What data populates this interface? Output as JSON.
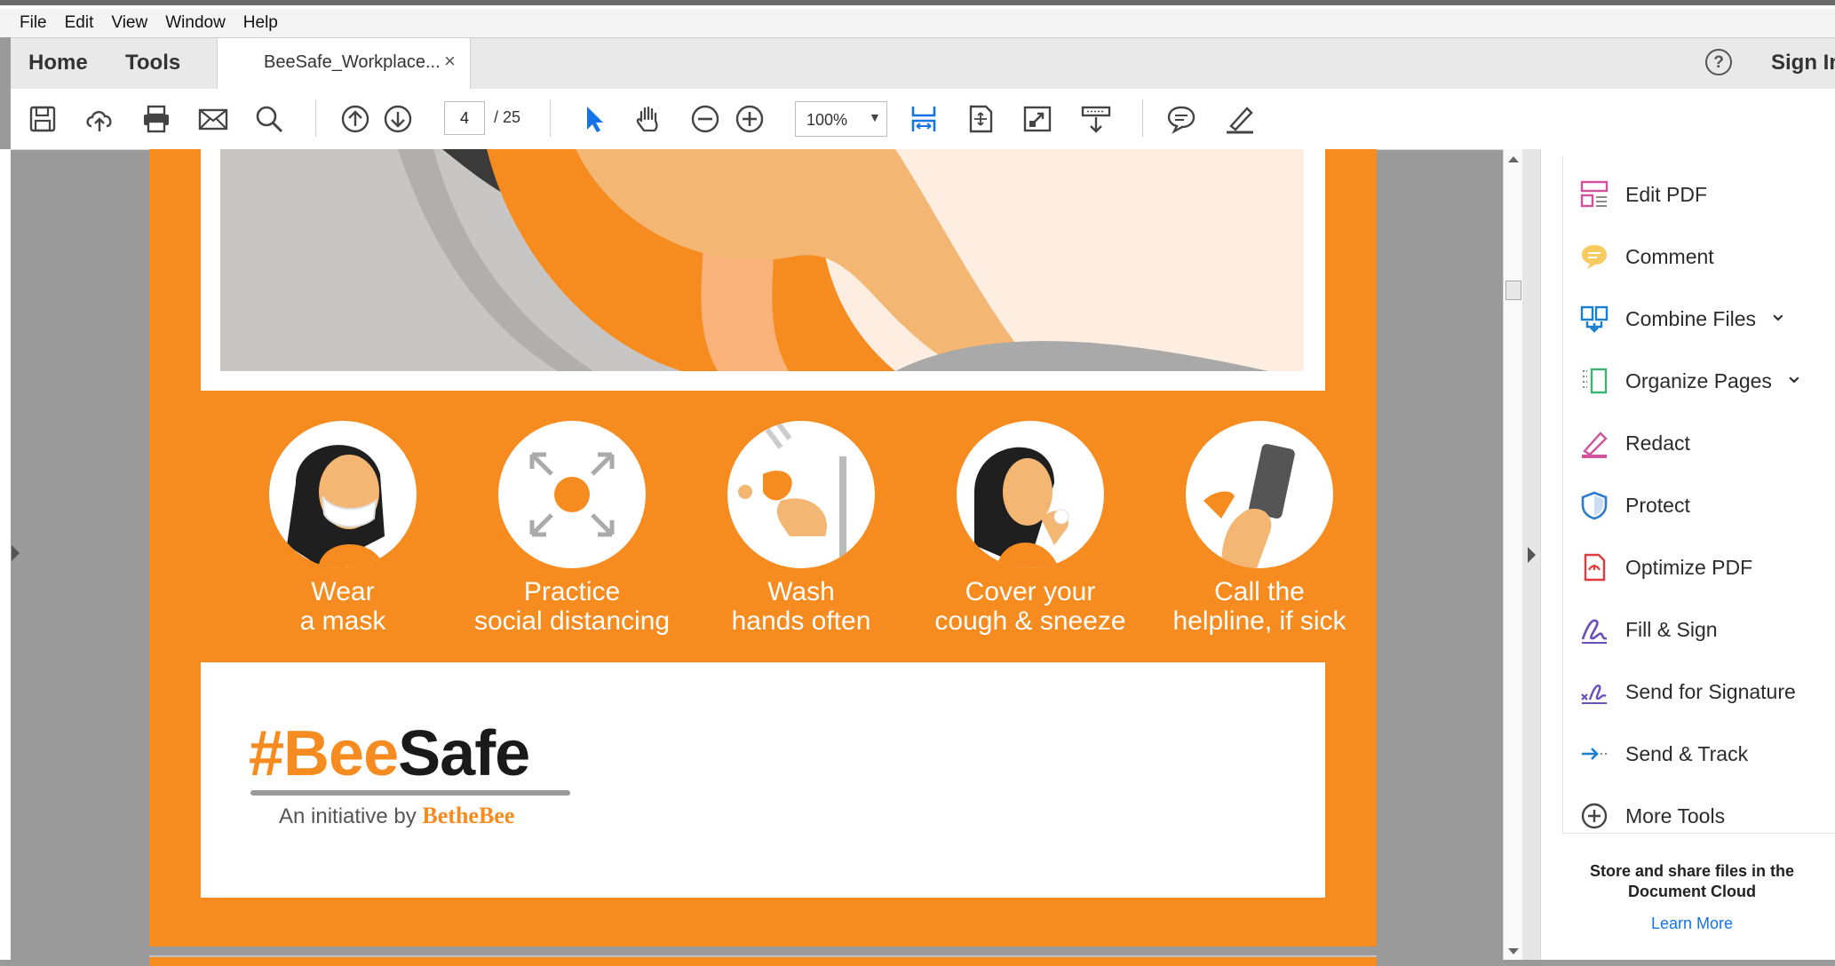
{
  "menu": [
    "File",
    "Edit",
    "View",
    "Window",
    "Help"
  ],
  "nav": {
    "home": "Home",
    "tools": "Tools"
  },
  "tab": {
    "title": "BeeSafe_Workplace...",
    "close": "×"
  },
  "header": {
    "help": "?",
    "sign_in": "Sign In"
  },
  "toolbar": {
    "page_current": "4",
    "page_total": "/ 25",
    "zoom": "100%",
    "icons": [
      "save-icon",
      "upload-icon",
      "print-icon",
      "email-icon",
      "search-icon",
      "page-up-icon",
      "page-down-icon",
      "select-cursor-icon",
      "hand-icon",
      "zoom-out-icon",
      "zoom-in-icon",
      "fit-width-icon",
      "fit-page-icon",
      "full-screen-icon",
      "scroll-mode-icon",
      "comment-icon",
      "highlight-icon"
    ]
  },
  "document": {
    "tips": [
      {
        "line1": "Wear",
        "line2": "a mask"
      },
      {
        "line1": "Practice",
        "line2": "social distancing"
      },
      {
        "line1": "Wash",
        "line2": "hands often"
      },
      {
        "line1": "Cover your",
        "line2": "cough & sneeze"
      },
      {
        "line1": "Call the",
        "line2": "helpline, if sick"
      }
    ],
    "logo": {
      "hash": "#",
      "bee": "Bee",
      "safe": "Safe",
      "tagline": "An initiative by ",
      "brand": "BetheBee"
    }
  },
  "tools_panel": {
    "items": [
      {
        "label": "Edit PDF",
        "icon": "edit-pdf-icon",
        "color": "#d1519c",
        "chevron": false
      },
      {
        "label": "Comment",
        "icon": "comment-icon",
        "color": "#f6c244",
        "chevron": false
      },
      {
        "label": "Combine Files",
        "icon": "combine-files-icon",
        "color": "#1a7fd0",
        "chevron": true
      },
      {
        "label": "Organize Pages",
        "icon": "organize-pages-icon",
        "color": "#3cb371",
        "chevron": true
      },
      {
        "label": "Redact",
        "icon": "redact-icon",
        "color": "#d1519c",
        "chevron": false
      },
      {
        "label": "Protect",
        "icon": "protect-icon",
        "color": "#2b7bd0",
        "chevron": false
      },
      {
        "label": "Optimize PDF",
        "icon": "optimize-pdf-icon",
        "color": "#e03a3a",
        "chevron": false
      },
      {
        "label": "Fill & Sign",
        "icon": "fill-sign-icon",
        "color": "#6b4fbb",
        "chevron": false
      },
      {
        "label": "Send for Signature",
        "icon": "send-signature-icon",
        "color": "#6b4fbb",
        "chevron": false
      },
      {
        "label": "Send & Track",
        "icon": "send-track-icon",
        "color": "#1a7fd0",
        "chevron": false
      },
      {
        "label": "More Tools",
        "icon": "more-tools-icon",
        "color": "#444444",
        "chevron": false
      }
    ],
    "cloud_text": "Store and share files in the Document Cloud",
    "learn_more": "Learn More"
  }
}
